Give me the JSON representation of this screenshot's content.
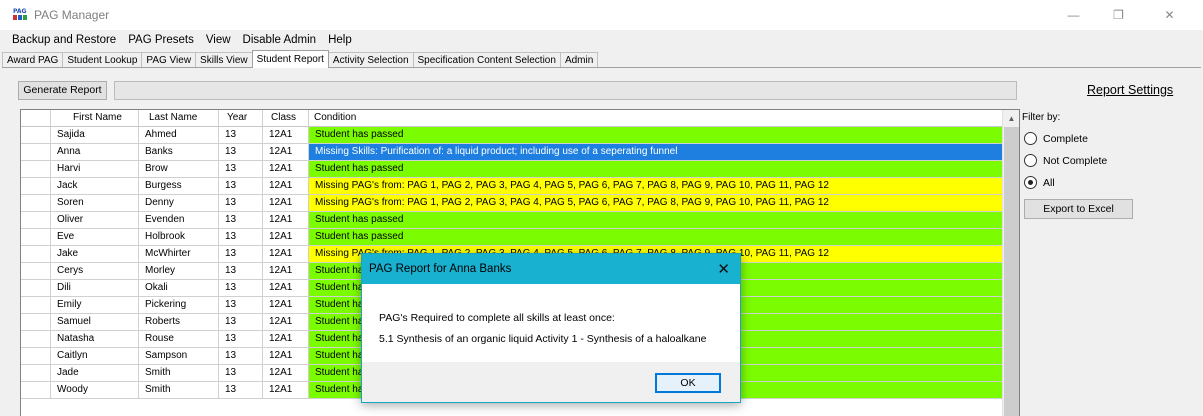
{
  "window": {
    "title": "PAG Manager",
    "icon": "pag-app-icon",
    "minimize_glyph": "—",
    "restore_glyph": "❐",
    "close_glyph": "✕"
  },
  "menu": [
    "Backup and Restore",
    "PAG Presets",
    "View",
    "Disable Admin",
    "Help"
  ],
  "tabs": [
    {
      "label": "Award PAG",
      "active": false
    },
    {
      "label": "Student Lookup",
      "active": false
    },
    {
      "label": "PAG View",
      "active": false
    },
    {
      "label": "Skills View",
      "active": false
    },
    {
      "label": "Student Report",
      "active": true
    },
    {
      "label": "Activity Selection",
      "active": false
    },
    {
      "label": "Specification Content Selection",
      "active": false
    },
    {
      "label": "Admin",
      "active": false
    }
  ],
  "toolbar": {
    "generate_label": "Generate Report"
  },
  "grid": {
    "columns": [
      "",
      "First Name",
      "Last Name",
      "Year",
      "Class",
      "Condition"
    ],
    "rows": [
      {
        "first": "Sajida",
        "last": "Ahmed",
        "year": "13",
        "class": "12A1",
        "condition": "Student has passed",
        "status": "green"
      },
      {
        "first": "Anna",
        "last": "Banks",
        "year": "13",
        "class": "12A1",
        "condition": "Missing Skills: Purification of: a liquid product; including use of a seperating funnel",
        "status": "blue"
      },
      {
        "first": "Harvi",
        "last": "Brow",
        "year": "13",
        "class": "12A1",
        "condition": "Student has passed",
        "status": "green"
      },
      {
        "first": "Jack",
        "last": "Burgess",
        "year": "13",
        "class": "12A1",
        "condition": "Missing PAG's from: PAG 1, PAG 2, PAG 3, PAG 4, PAG 5, PAG 6, PAG 7, PAG 8, PAG 9, PAG 10, PAG 11, PAG 12",
        "status": "yellow"
      },
      {
        "first": "Soren",
        "last": "Denny",
        "year": "13",
        "class": "12A1",
        "condition": "Missing PAG's from: PAG 1, PAG 2, PAG 3, PAG 4, PAG 5, PAG 6, PAG 7, PAG 8, PAG 9, PAG 10, PAG 11, PAG 12",
        "status": "yellow"
      },
      {
        "first": "Oliver",
        "last": "Evenden",
        "year": "13",
        "class": "12A1",
        "condition": "Student has passed",
        "status": "green"
      },
      {
        "first": "Eve",
        "last": "Holbrook",
        "year": "13",
        "class": "12A1",
        "condition": "Student has passed",
        "status": "green"
      },
      {
        "first": "Jake",
        "last": "McWhirter",
        "year": "13",
        "class": "12A1",
        "condition": "Missing PAG's from: PAG 1, PAG 2, PAG 3, PAG 4, PAG 5, PAG 6, PAG 7, PAG 8, PAG 9, PAG 10, PAG 11, PAG 12",
        "status": "yellow"
      },
      {
        "first": "Cerys",
        "last": "Morley",
        "year": "13",
        "class": "12A1",
        "condition": "Student has passed",
        "status": "green"
      },
      {
        "first": "Dili",
        "last": "Okali",
        "year": "13",
        "class": "12A1",
        "condition": "Student has passed",
        "status": "green"
      },
      {
        "first": "Emily",
        "last": "Pickering",
        "year": "13",
        "class": "12A1",
        "condition": "Student has passed",
        "status": "green"
      },
      {
        "first": "Samuel",
        "last": "Roberts",
        "year": "13",
        "class": "12A1",
        "condition": "Student has passed",
        "status": "green"
      },
      {
        "first": "Natasha",
        "last": "Rouse",
        "year": "13",
        "class": "12A1",
        "condition": "Student has passed",
        "status": "green"
      },
      {
        "first": "Caitlyn",
        "last": "Sampson",
        "year": "13",
        "class": "12A1",
        "condition": "Student has passed",
        "status": "green"
      },
      {
        "first": "Jade",
        "last": "Smith",
        "year": "13",
        "class": "12A1",
        "condition": "Student has passed",
        "status": "green"
      },
      {
        "first": "Woody",
        "last": "Smith",
        "year": "13",
        "class": "12A1",
        "condition": "Student has passed",
        "status": "green"
      }
    ]
  },
  "status_colors": {
    "green": "#7cfc00",
    "yellow": "#ffff00",
    "blue": "#1e7fe0"
  },
  "settings": {
    "title": "Report Settings",
    "filter_label": "Filter by:",
    "options": [
      {
        "label": "Complete",
        "checked": false
      },
      {
        "label": "Not Complete",
        "checked": false
      },
      {
        "label": "All",
        "checked": true
      }
    ],
    "export_label": "Export to Excel"
  },
  "dialog": {
    "title": "PAG Report for Anna Banks",
    "line1": "PAG's Required to complete all skills at least once:",
    "line2": "5.1 Synthesis of an organic liquid Activity 1 - Synthesis of a haloalkane",
    "ok_label": "OK",
    "accent": "#18b1cf"
  }
}
